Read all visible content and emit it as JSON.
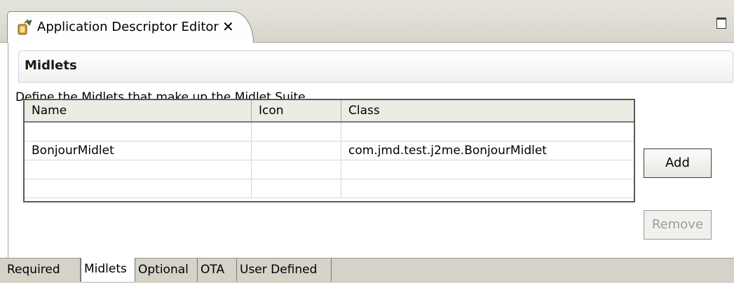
{
  "editor": {
    "tab_title": "Application Descriptor Editor"
  },
  "section": {
    "title": "Midlets",
    "description": "Define the Midlets that make up the Midlet Suite"
  },
  "table": {
    "columns": [
      "Name",
      "Icon",
      "Class"
    ],
    "rows": [
      [
        "",
        "",
        ""
      ],
      [
        "BonjourMidlet",
        "",
        "com.jmd.test.j2me.BonjourMidlet"
      ],
      [
        "",
        "",
        ""
      ],
      [
        "",
        "",
        ""
      ]
    ]
  },
  "buttons": {
    "add": "Add",
    "remove": "Remove",
    "remove_enabled": false
  },
  "page_tabs": {
    "items": [
      "Required",
      "Midlets",
      "Optional",
      "OTA",
      "User Defined"
    ],
    "active": "Midlets"
  },
  "colors": {
    "frame_bg": "#d5d2ca",
    "section_border": "#c7d4e6",
    "disabled_text": "#9c9c9c"
  },
  "icons": [
    "app-descriptor-icon",
    "close-icon",
    "maximize-icon"
  ]
}
